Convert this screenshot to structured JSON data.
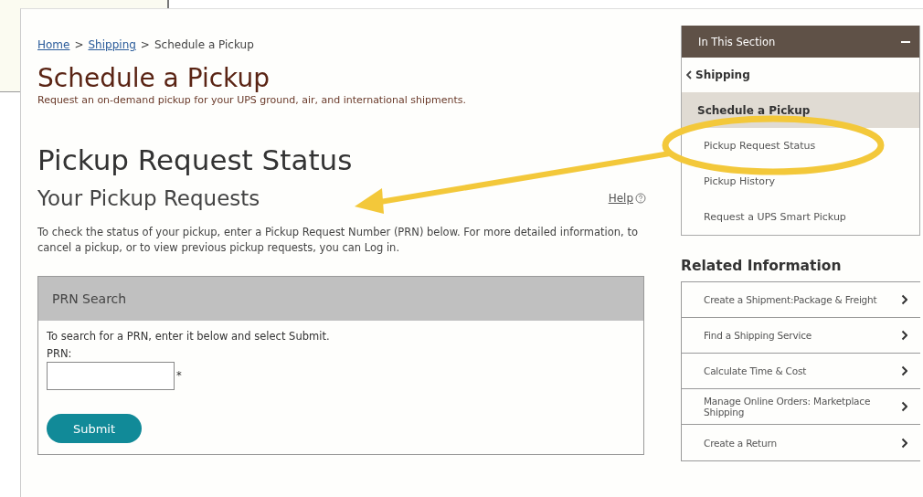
{
  "breadcrumb": {
    "separator": ">",
    "items": [
      {
        "label": "Home",
        "link": true
      },
      {
        "label": "Shipping",
        "link": true
      },
      {
        "label": "Schedule a Pickup",
        "link": false
      }
    ]
  },
  "page_title": "Schedule a Pickup",
  "page_subtitle": "Request an on-demand pickup for your UPS ground, air, and international shipments.",
  "section_title": "Pickup Request Status",
  "subheading": "Your Pickup Requests",
  "help_link": "Help",
  "intro": "To check the status of your pickup, enter a Pickup Request Number (PRN) below. For more detailed information, to cancel a pickup, or to view previous pickup requests, you can Log in.",
  "prn_search": {
    "title": "PRN Search",
    "instructions": "To search for a PRN, enter it below and select Submit.",
    "field_label": "PRN:",
    "required_mark": "*",
    "button": "Submit"
  },
  "in_this_section": {
    "title": "In This Section",
    "expanded": true,
    "back": "Shipping",
    "items": [
      {
        "label": "Schedule a Pickup",
        "selected": true
      },
      {
        "label": "Pickup Request Status",
        "selected": false
      },
      {
        "label": "Pickup History",
        "selected": false
      },
      {
        "label": "Request a UPS Smart Pickup",
        "selected": false
      }
    ]
  },
  "related": {
    "title": "Related Information",
    "items": [
      "Create a Shipment:Package & Freight",
      "Find a Shipping Service",
      "Calculate Time & Cost",
      "Manage Online Orders: Marketplace Shipping",
      "Create a Return"
    ]
  }
}
